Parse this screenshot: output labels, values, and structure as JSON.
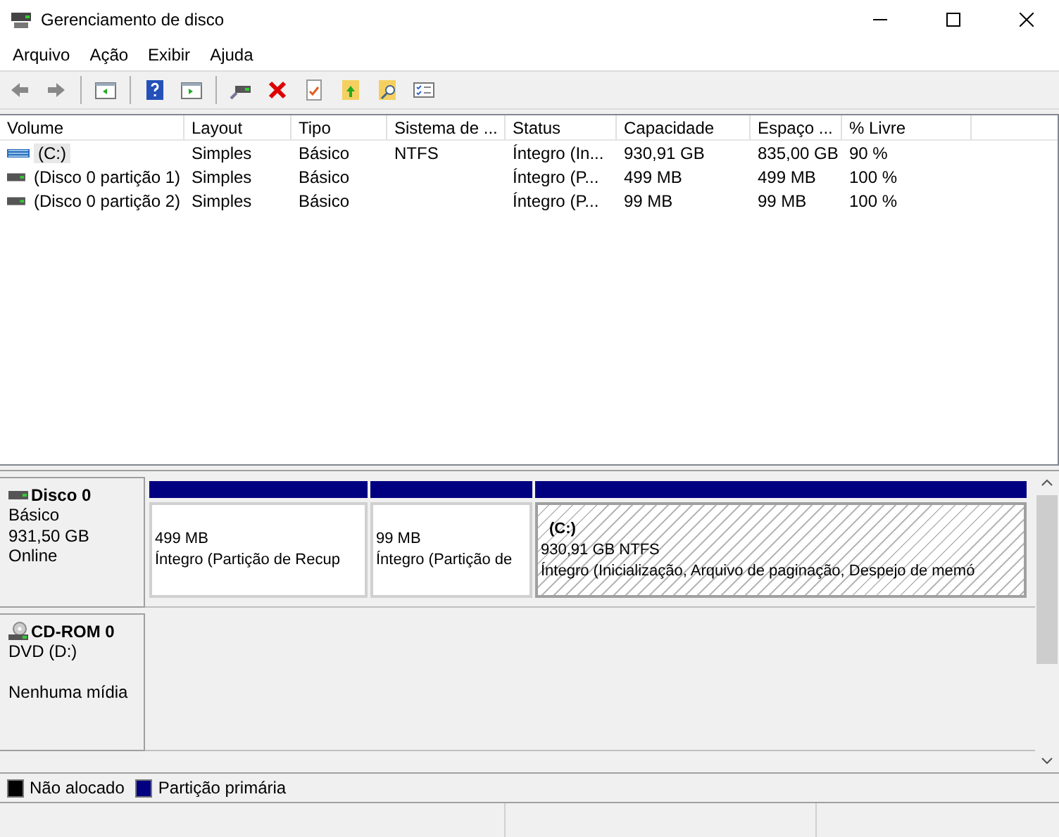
{
  "window": {
    "title": "Gerenciamento de disco"
  },
  "menu": [
    "Arquivo",
    "Ação",
    "Exibir",
    "Ajuda"
  ],
  "volume_list": {
    "columns": [
      "Volume",
      "Layout",
      "Tipo",
      "Sistema de ...",
      "Status",
      "Capacidade",
      "Espaço ...",
      "% Livre"
    ],
    "rows": [
      {
        "kind": "volume",
        "selected": true,
        "cells": [
          "(C:)",
          "Simples",
          "Básico",
          "NTFS",
          "Íntegro (In...",
          "930,91 GB",
          "835,00 GB",
          "90 %"
        ]
      },
      {
        "kind": "partition",
        "selected": false,
        "cells": [
          "(Disco 0 partição 1)",
          "Simples",
          "Básico",
          "",
          "Íntegro (P...",
          "499 MB",
          "499 MB",
          "100 %"
        ]
      },
      {
        "kind": "partition",
        "selected": false,
        "cells": [
          "(Disco 0 partição 2)",
          "Simples",
          "Básico",
          "",
          "Íntegro (P...",
          "99 MB",
          "99 MB",
          "100 %"
        ]
      }
    ]
  },
  "disks": [
    {
      "kind": "disk",
      "name": "Disco 0",
      "type": "Básico",
      "size": "931,50 GB",
      "state": "Online",
      "partitions": [
        {
          "selected": false,
          "size": "499 MB",
          "status": "Íntegro (Partição de Recup"
        },
        {
          "selected": false,
          "size": "99 MB",
          "status": "Íntegro (Partição de"
        },
        {
          "selected": true,
          "label": "(C:)",
          "size": "930,91 GB NTFS",
          "status": "Íntegro (Inicialização, Arquivo de paginação, Despejo de memó"
        }
      ]
    },
    {
      "kind": "cdrom",
      "name": "CD-ROM 0",
      "type": "DVD (D:)",
      "state": "Nenhuma mídia"
    }
  ],
  "legend": [
    {
      "label": "Não alocado",
      "color": "#000000"
    },
    {
      "label": "Partição primária",
      "color": "#000080"
    }
  ]
}
